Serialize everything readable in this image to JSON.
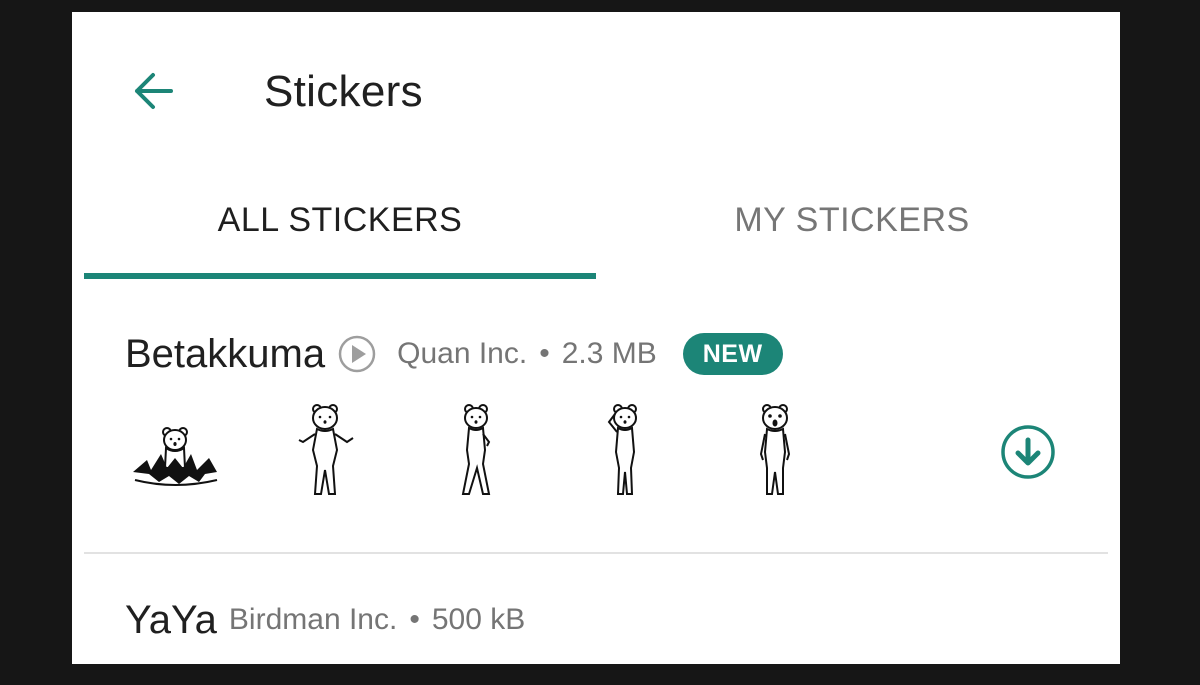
{
  "header": {
    "title": "Stickers",
    "back_icon": "arrow-left-icon"
  },
  "tabs": [
    {
      "label": "ALL STICKERS",
      "active": true
    },
    {
      "label": "MY STICKERS",
      "active": false
    }
  ],
  "accent_color": "#1c8577",
  "packs": [
    {
      "name": "Betakkuma",
      "publisher": "Quan Inc.",
      "separator": "•",
      "size": "2.3 MB",
      "badge": "NEW",
      "animated_icon": "play-circle-icon",
      "action_icon": "download-circle-icon",
      "stickers": [
        "bear-explosion-sticker",
        "bear-dancing-sticker",
        "bear-walking-sticker",
        "bear-saluting-sticker",
        "bear-shocked-sticker"
      ]
    },
    {
      "name": "YaYa",
      "publisher": "Birdman Inc.",
      "separator": "•",
      "size": "500 kB"
    }
  ]
}
